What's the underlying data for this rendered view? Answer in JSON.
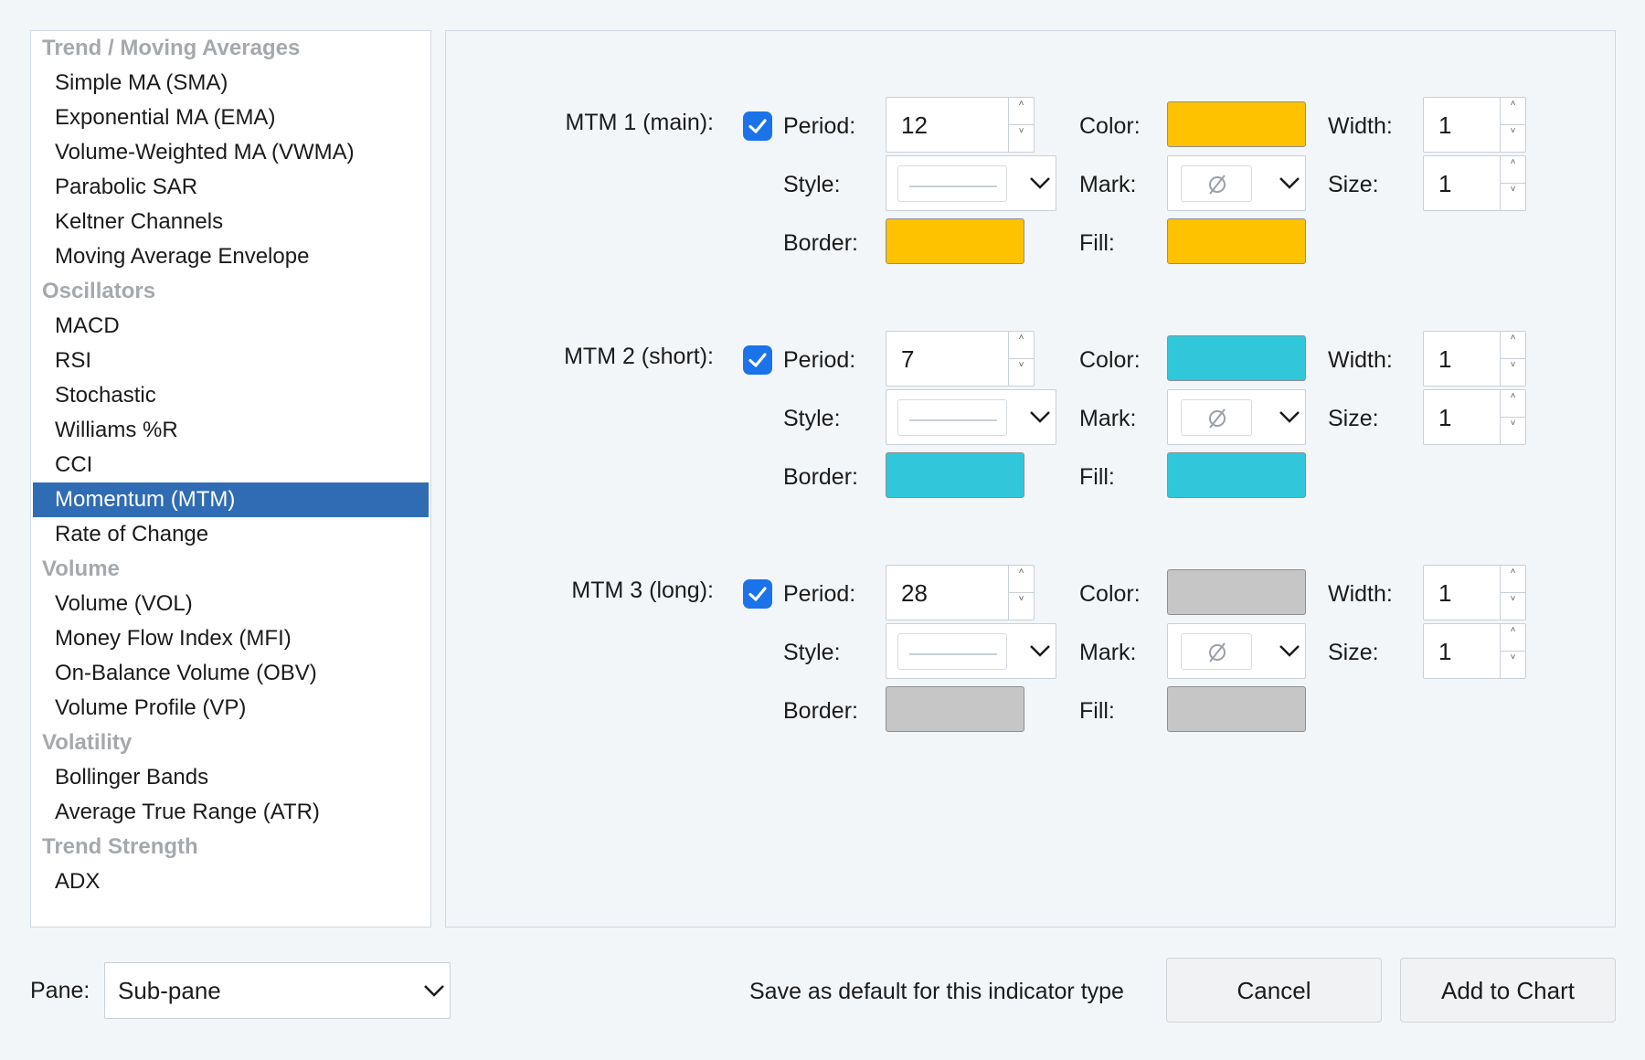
{
  "indicator_list": {
    "rows": [
      {
        "kind": "cat",
        "label": "Trend / Moving Averages"
      },
      {
        "kind": "item",
        "label": "Simple MA (SMA)"
      },
      {
        "kind": "item",
        "label": "Exponential MA (EMA)"
      },
      {
        "kind": "item",
        "label": "Volume-Weighted MA (VWMA)"
      },
      {
        "kind": "item",
        "label": "Parabolic SAR"
      },
      {
        "kind": "item",
        "label": "Keltner Channels"
      },
      {
        "kind": "item",
        "label": "Moving Average Envelope"
      },
      {
        "kind": "cat",
        "label": "Oscillators"
      },
      {
        "kind": "item",
        "label": "MACD"
      },
      {
        "kind": "item",
        "label": "RSI"
      },
      {
        "kind": "item",
        "label": "Stochastic"
      },
      {
        "kind": "item",
        "label": "Williams %R"
      },
      {
        "kind": "item",
        "label": "CCI"
      },
      {
        "kind": "item",
        "label": "Momentum (MTM)",
        "selected": true
      },
      {
        "kind": "item",
        "label": "Rate of Change"
      },
      {
        "kind": "cat",
        "label": "Volume"
      },
      {
        "kind": "item",
        "label": "Volume (VOL)"
      },
      {
        "kind": "item",
        "label": "Money Flow Index (MFI)"
      },
      {
        "kind": "item",
        "label": "On-Balance Volume (OBV)"
      },
      {
        "kind": "item",
        "label": "Volume Profile (VP)"
      },
      {
        "kind": "cat",
        "label": "Volatility"
      },
      {
        "kind": "item",
        "label": "Bollinger Bands"
      },
      {
        "kind": "item",
        "label": "Average True Range (ATR)"
      },
      {
        "kind": "cat",
        "label": "Trend Strength"
      },
      {
        "kind": "item",
        "label": "ADX"
      }
    ]
  },
  "field_labels": {
    "period": "Period:",
    "color": "Color:",
    "width": "Width:",
    "style": "Style:",
    "mark": "Mark:",
    "size": "Size:",
    "border": "Border:",
    "fill": "Fill:"
  },
  "lines": [
    {
      "title": "MTM 1 (main):",
      "checked": true,
      "period": "12",
      "color": "#ffc200",
      "width": "1",
      "size": "1",
      "border_color": "#ffc200",
      "fill_color": "#ffc200",
      "mark_icon": "empty-set-icon"
    },
    {
      "title": "MTM 2 (short):",
      "checked": true,
      "period": "7",
      "color": "#31c7da",
      "width": "1",
      "size": "1",
      "border_color": "#31c7da",
      "fill_color": "#31c7da",
      "mark_icon": "empty-set-icon"
    },
    {
      "title": "MTM 3 (long):",
      "checked": true,
      "period": "28",
      "color": "#c6c6c6",
      "width": "1",
      "size": "1",
      "border_color": "#c6c6c6",
      "fill_color": "#c6c6c6",
      "mark_icon": "empty-set-icon"
    }
  ],
  "footer": {
    "pane_label": "Pane:",
    "pane_value": "Sub-pane",
    "save_default_label": "Save as default for this indicator type",
    "cancel_label": "Cancel",
    "add_label": "Add to Chart"
  },
  "colors": {
    "selected_row": "#2f6cb4",
    "checkbox": "#1a73e8",
    "category_text": "#a5a9ad"
  }
}
